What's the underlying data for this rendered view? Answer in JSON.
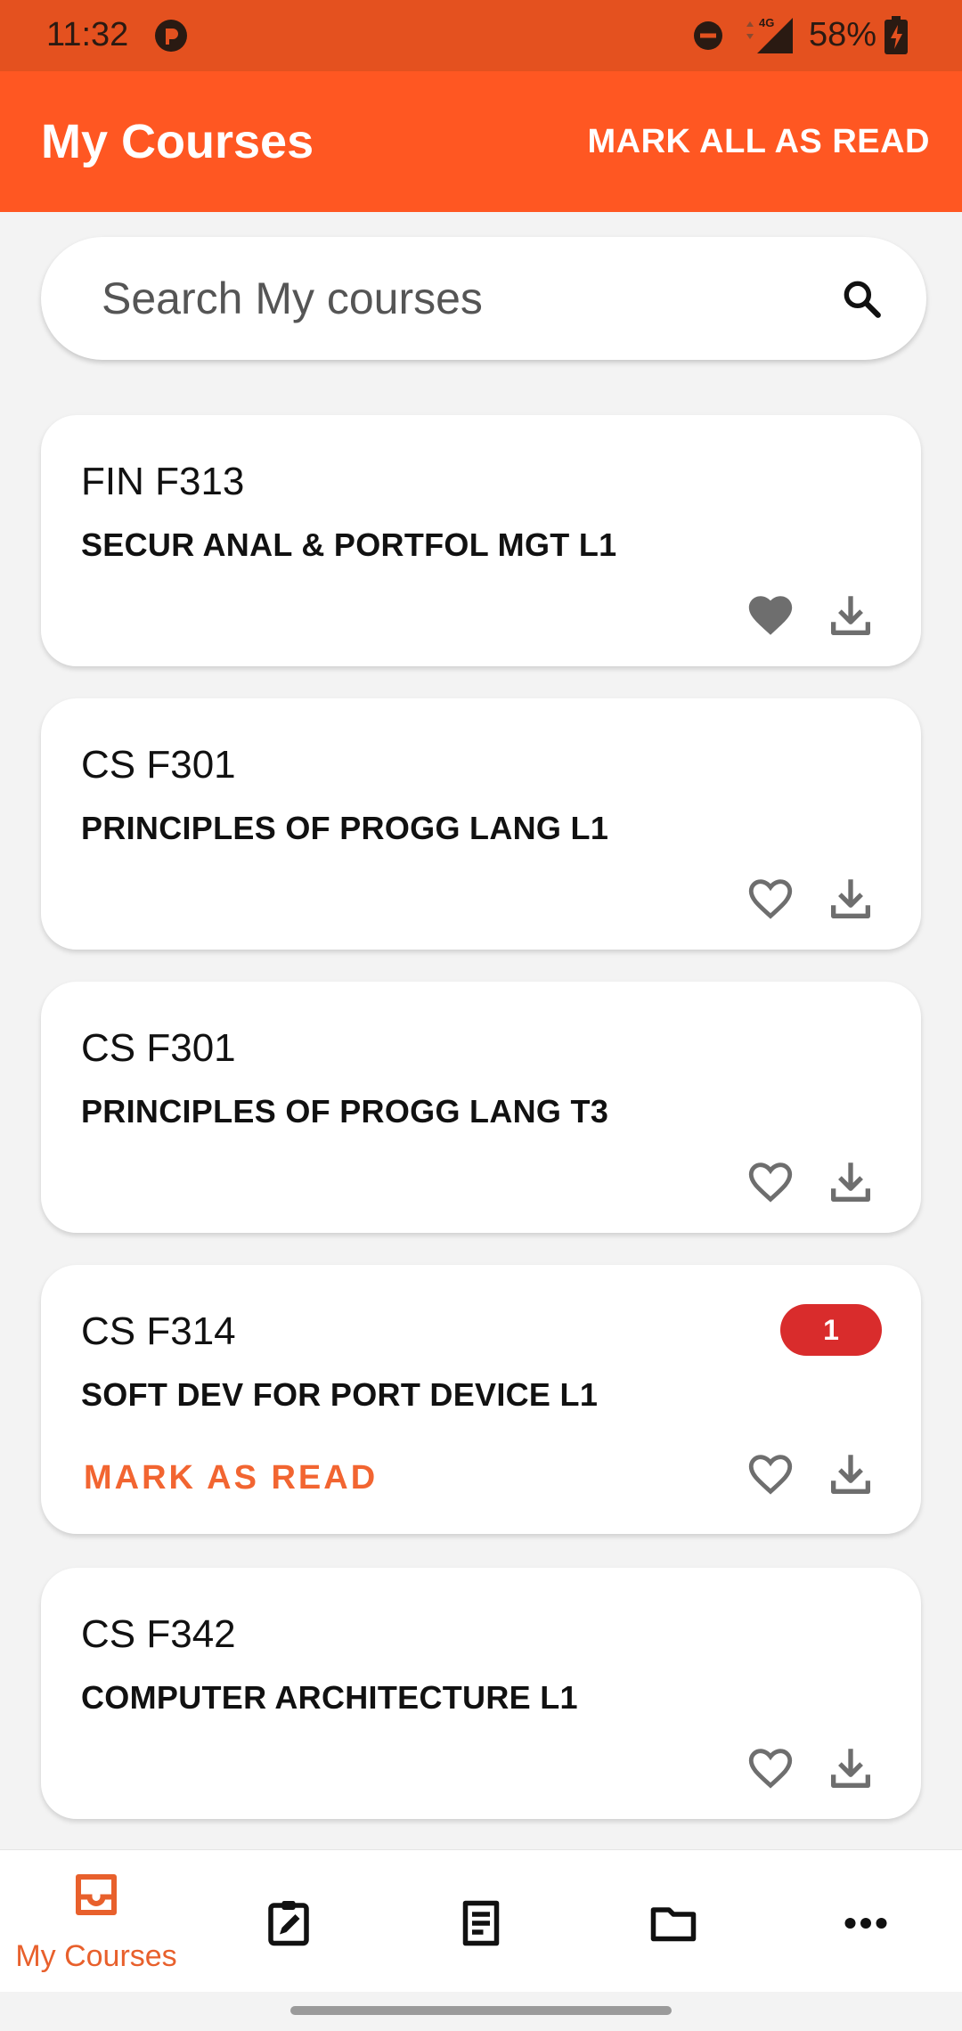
{
  "status_bar": {
    "time": "11:32",
    "network": "4G",
    "battery": "58%"
  },
  "app_bar": {
    "title": "My Courses",
    "mark_all_label": "MARK ALL AS READ"
  },
  "search": {
    "placeholder": "Search My courses"
  },
  "courses": [
    {
      "code": "FIN F313",
      "name": "SECUR ANAL & PORTFOL MGT L1",
      "favorite": true
    },
    {
      "code": "CS F301",
      "name": "PRINCIPLES OF PROGG LANG L1",
      "favorite": false
    },
    {
      "code": "CS F301",
      "name": "PRINCIPLES OF PROGG LANG T3",
      "favorite": false
    },
    {
      "code": "CS F314",
      "name": "SOFT DEV FOR PORT DEVICE L1",
      "favorite": false,
      "unread": "1",
      "mark_read_label": "MARK AS READ"
    },
    {
      "code": "CS F342",
      "name": "COMPUTER ARCHITECTURE L1",
      "favorite": false
    }
  ],
  "bottom_nav": {
    "items": [
      {
        "label": "My Courses",
        "icon": "inbox-icon",
        "active": true
      },
      {
        "label": "",
        "icon": "assignment-icon"
      },
      {
        "label": "",
        "icon": "notes-icon"
      },
      {
        "label": "",
        "icon": "folder-icon"
      },
      {
        "label": "",
        "icon": "more-icon"
      }
    ]
  },
  "colors": {
    "accent": "#ff5722",
    "status_bar": "#e4511f",
    "badge": "#d92c2c",
    "active_nav": "#e8602c"
  }
}
